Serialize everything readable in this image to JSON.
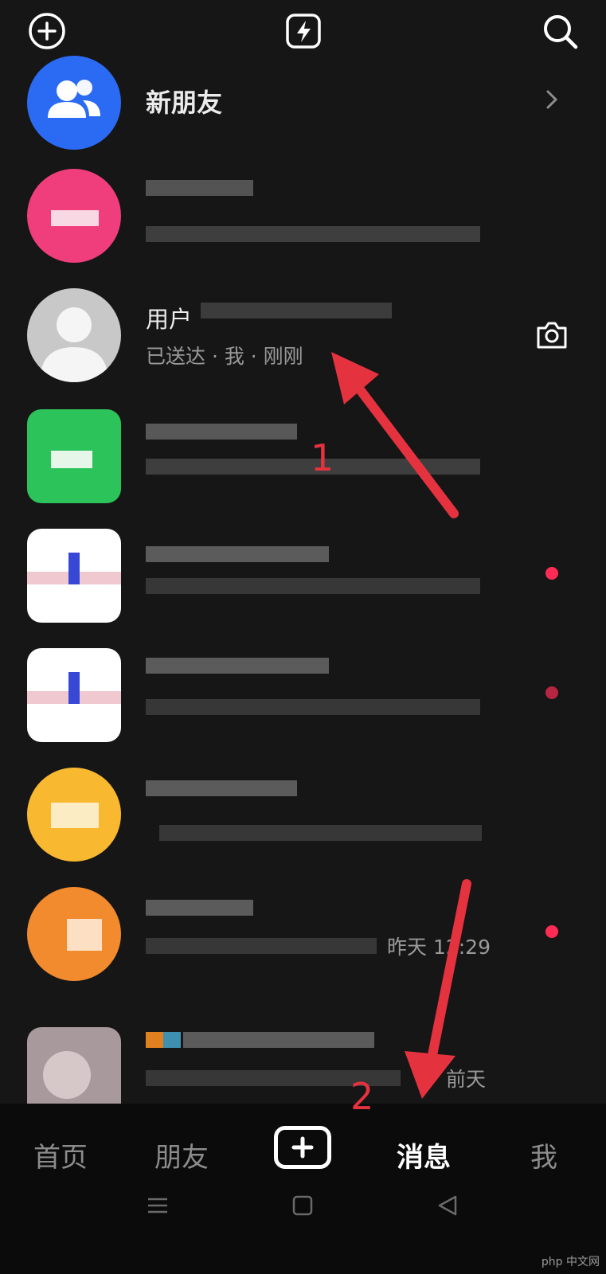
{
  "colors": {
    "background": "#161616",
    "accent": "#fe2c55",
    "annotation": "#e5323f"
  },
  "topbar": {
    "left_icon": "add-circle-icon",
    "center_icon": "flash-icon",
    "right_icon": "search-icon"
  },
  "new_friends": {
    "label": "新朋友",
    "icon": "people-icon"
  },
  "conversations": [
    {
      "name": "",
      "subtitle": "",
      "avatar_color": "#f03d7b",
      "unread": false
    },
    {
      "name": "用户",
      "subtitle": "已送达 · 我 · 刚刚",
      "avatar_color": "#c8c8c8",
      "action_icon": "camera-icon",
      "unread": false
    },
    {
      "name": "",
      "subtitle": "",
      "avatar_color": "#2cc35a",
      "unread": false
    },
    {
      "name": "",
      "subtitle": "",
      "avatar_color": "#ffffff",
      "unread": true
    },
    {
      "name": "",
      "subtitle": "",
      "avatar_color": "#ffffff",
      "unread": true
    },
    {
      "name": "",
      "subtitle": "",
      "avatar_color": "#f8b830",
      "unread": false
    },
    {
      "name": "",
      "subtitle": "昨天 12:29",
      "avatar_color": "#f28a2e",
      "unread": true
    },
    {
      "name": "",
      "subtitle": "前天",
      "avatar_color": "#a89a9c",
      "unread": false
    }
  ],
  "tabs": [
    "首页",
    "朋友",
    "消息",
    "我"
  ],
  "active_tab": "消息",
  "annotations": {
    "arrow1": "1",
    "arrow2": "2"
  },
  "watermark": "php 中文网"
}
